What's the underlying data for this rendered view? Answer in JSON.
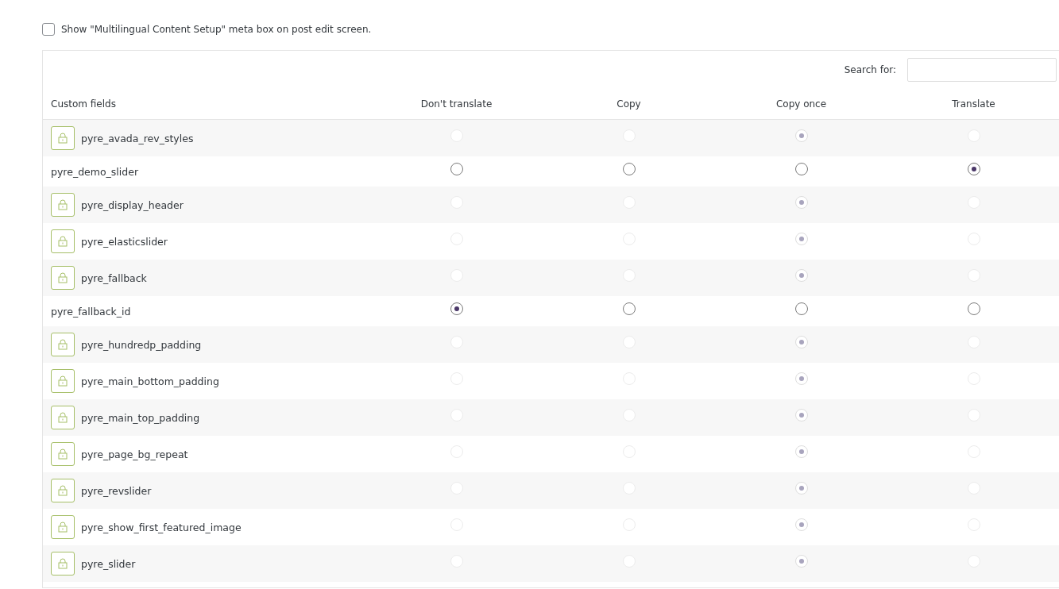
{
  "meta_box_option": {
    "label": "Show \"Multilingual Content Setup\" meta box on post edit screen.",
    "checked": false
  },
  "search": {
    "label": "Search for:"
  },
  "columns": [
    "Custom fields",
    "Don't translate",
    "Copy",
    "Copy once",
    "Translate"
  ],
  "rows": [
    {
      "name": "pyre_avada_rev_styles",
      "locked": true,
      "options": [
        {
          "selected": false
        },
        {
          "selected": false
        },
        {
          "selected": true
        },
        {
          "selected": false
        }
      ]
    },
    {
      "name": "pyre_demo_slider",
      "locked": false,
      "options": [
        {
          "selected": false
        },
        {
          "selected": false
        },
        {
          "selected": false
        },
        {
          "selected": true
        }
      ]
    },
    {
      "name": "pyre_display_header",
      "locked": true,
      "options": [
        {
          "selected": false
        },
        {
          "selected": false
        },
        {
          "selected": true
        },
        {
          "selected": false
        }
      ]
    },
    {
      "name": "pyre_elasticslider",
      "locked": true,
      "options": [
        {
          "selected": false
        },
        {
          "selected": false
        },
        {
          "selected": true
        },
        {
          "selected": false
        }
      ]
    },
    {
      "name": "pyre_fallback",
      "locked": true,
      "options": [
        {
          "selected": false
        },
        {
          "selected": false
        },
        {
          "selected": true
        },
        {
          "selected": false
        }
      ]
    },
    {
      "name": "pyre_fallback_id",
      "locked": false,
      "options": [
        {
          "selected": true
        },
        {
          "selected": false
        },
        {
          "selected": false
        },
        {
          "selected": false
        }
      ]
    },
    {
      "name": "pyre_hundredp_padding",
      "locked": true,
      "options": [
        {
          "selected": false
        },
        {
          "selected": false
        },
        {
          "selected": true
        },
        {
          "selected": false
        }
      ]
    },
    {
      "name": "pyre_main_bottom_padding",
      "locked": true,
      "options": [
        {
          "selected": false
        },
        {
          "selected": false
        },
        {
          "selected": true
        },
        {
          "selected": false
        }
      ]
    },
    {
      "name": "pyre_main_top_padding",
      "locked": true,
      "options": [
        {
          "selected": false
        },
        {
          "selected": false
        },
        {
          "selected": true
        },
        {
          "selected": false
        }
      ]
    },
    {
      "name": "pyre_page_bg_repeat",
      "locked": true,
      "options": [
        {
          "selected": false
        },
        {
          "selected": false
        },
        {
          "selected": true
        },
        {
          "selected": false
        }
      ]
    },
    {
      "name": "pyre_revslider",
      "locked": true,
      "options": [
        {
          "selected": false
        },
        {
          "selected": false
        },
        {
          "selected": true
        },
        {
          "selected": false
        }
      ]
    },
    {
      "name": "pyre_show_first_featured_image",
      "locked": true,
      "options": [
        {
          "selected": false
        },
        {
          "selected": false
        },
        {
          "selected": true
        },
        {
          "selected": false
        }
      ]
    },
    {
      "name": "pyre_slider",
      "locked": true,
      "options": [
        {
          "selected": false
        },
        {
          "selected": false
        },
        {
          "selected": true
        },
        {
          "selected": false
        }
      ]
    }
  ]
}
